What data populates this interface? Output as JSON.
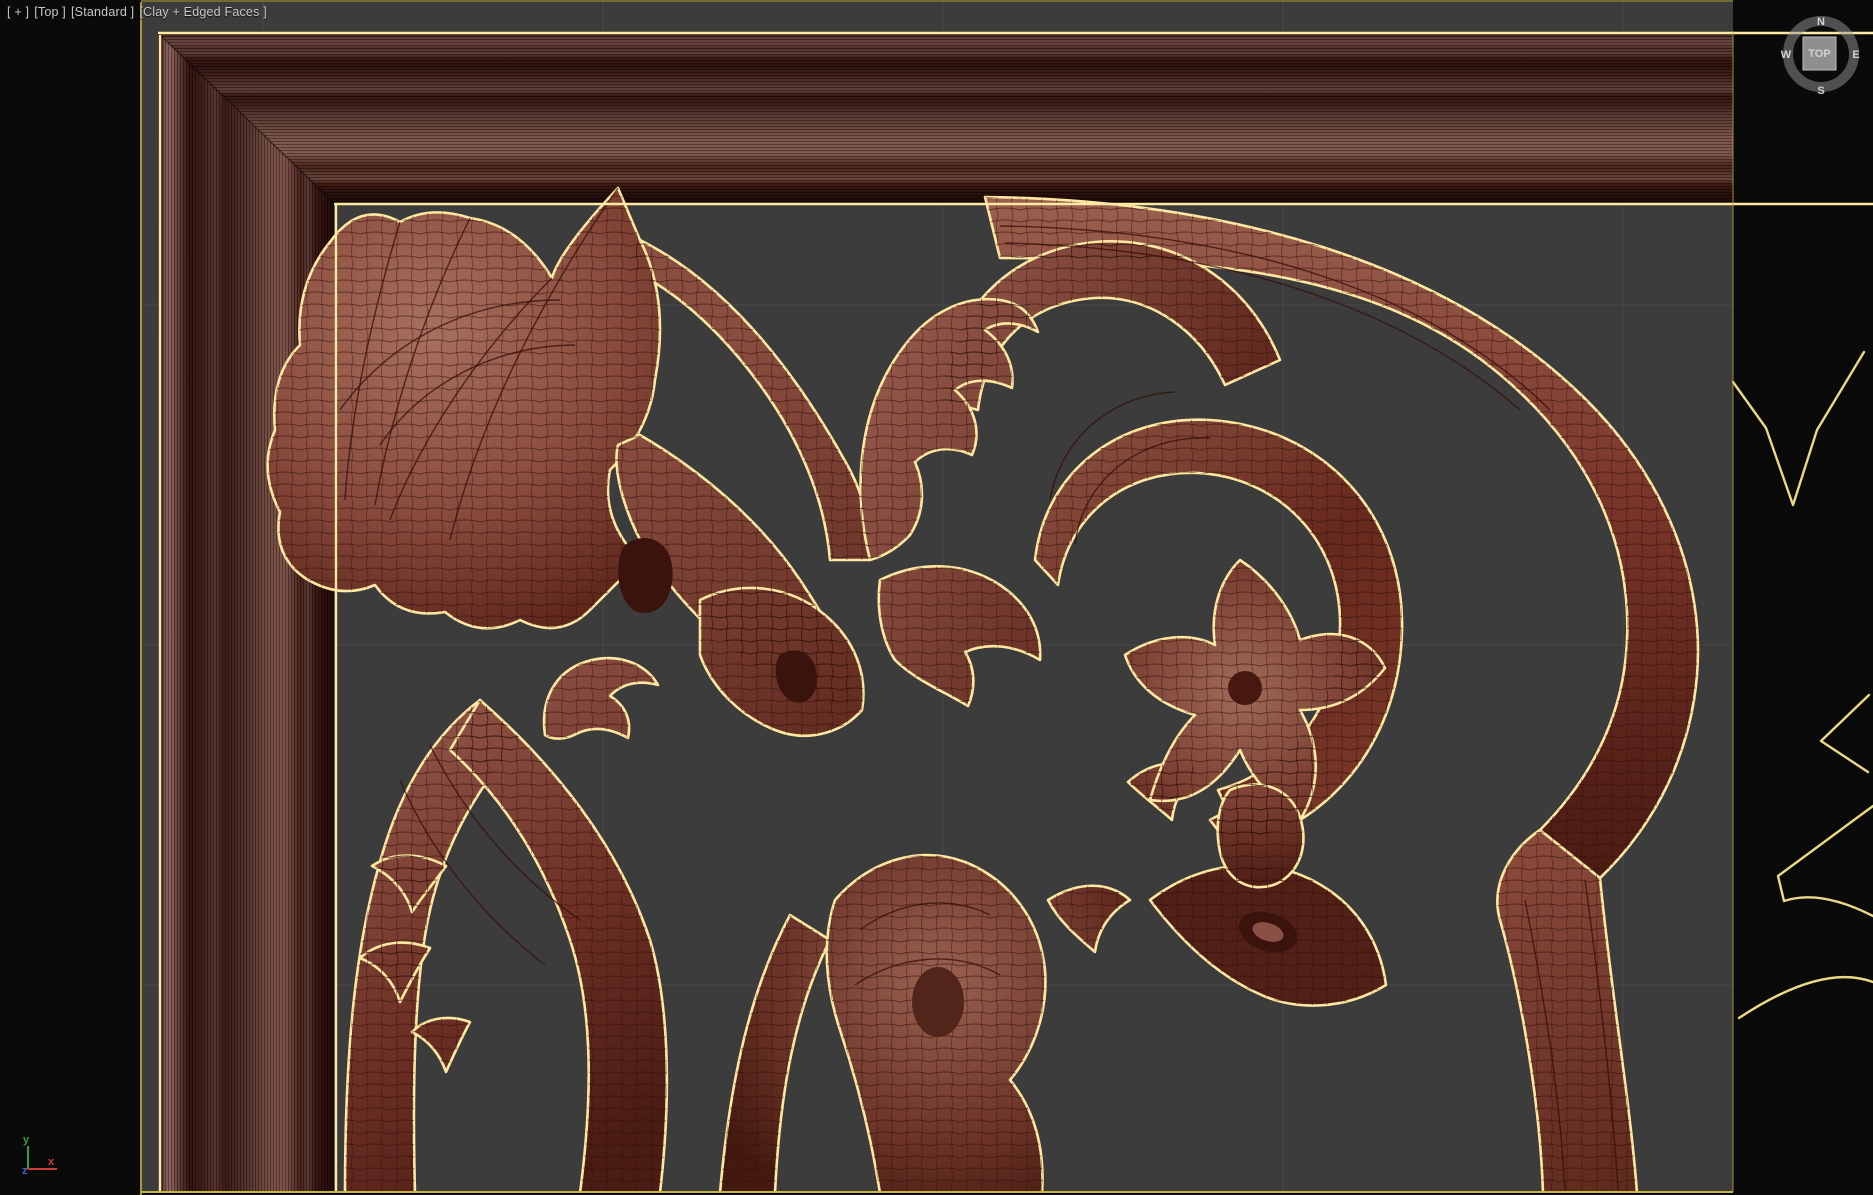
{
  "viewport": {
    "label_menu": "[ + ]",
    "label_view": "[Top ]",
    "label_preset": "[Standard ]",
    "label_shading": "[Clay + Edged Faces ]",
    "view_name": "Top",
    "shading_mode": "Clay + Edged Faces"
  },
  "viewcube": {
    "face_label": "TOP",
    "north": "N",
    "east": "E",
    "south": "S",
    "west": "W"
  },
  "axis_tripod": {
    "x": "x",
    "y": "y",
    "z": "z"
  },
  "colors": {
    "app_background": "#0a0a0a",
    "viewport_background": "#3c3c3c",
    "grid_line": "#474747",
    "selection_outline": "#ffe9a2",
    "active_viewport_border": "#b7a636",
    "clay_base": "#8a5046",
    "clay_dark": "#451d15",
    "axis_x": "#cc3a33",
    "axis_y": "#3f9b3f",
    "axis_z": "#4a5fd0"
  }
}
